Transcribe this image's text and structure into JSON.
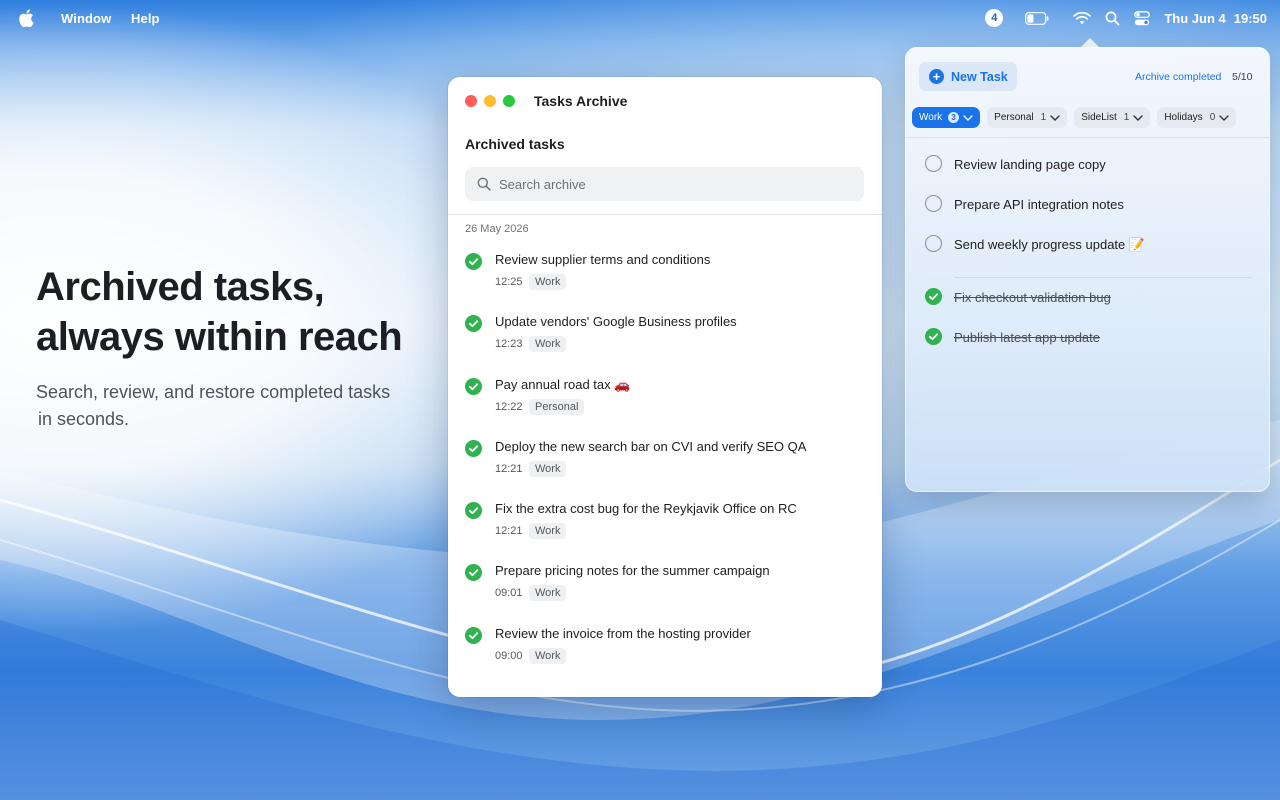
{
  "menubar": {
    "menus": [
      "Window",
      "Help"
    ],
    "notification_count": "4",
    "date": "Thu Jun 4",
    "time": "19:50"
  },
  "hero": {
    "title_line1": "Archived tasks,",
    "title_line2": "always within reach",
    "subtitle_line1": "Search, review, and restore completed tasks",
    "subtitle_line2": "in seconds."
  },
  "archive_window": {
    "title": "Tasks Archive",
    "heading": "Archived tasks",
    "search_placeholder": "Search archive",
    "date_group": "26 May 2026",
    "items": [
      {
        "title": "Review supplier terms and conditions",
        "time": "12:25",
        "tag": "Work"
      },
      {
        "title": "Update vendors' Google Business profiles",
        "time": "12:23",
        "tag": "Work"
      },
      {
        "title": "Pay annual road tax 🚗",
        "time": "12:22",
        "tag": "Personal"
      },
      {
        "title": "Deploy the new search bar on CVI and verify SEO QA",
        "time": "12:21",
        "tag": "Work"
      },
      {
        "title": "Fix the extra cost bug for the Reykjavik Office on RC",
        "time": "12:21",
        "tag": "Work"
      },
      {
        "title": "Prepare pricing notes for the summer campaign",
        "time": "09:01",
        "tag": "Work"
      },
      {
        "title": "Review the invoice from the hosting provider",
        "time": "09:00",
        "tag": "Work"
      }
    ]
  },
  "popover": {
    "new_task_label": "New Task",
    "archive_completed_label": "Archive completed",
    "count": "5/10",
    "lists": [
      {
        "name": "Work",
        "count": "3",
        "active": true
      },
      {
        "name": "Personal",
        "count": "1",
        "active": false
      },
      {
        "name": "SideList",
        "count": "1",
        "active": false
      },
      {
        "name": "Holidays",
        "count": "0",
        "active": false
      }
    ],
    "open_tasks": [
      "Review landing page copy",
      "Prepare API integration notes",
      "Send weekly progress update 📝"
    ],
    "done_tasks": [
      "Fix checkout validation bug",
      "Publish latest app update"
    ]
  },
  "colors": {
    "accent": "#1a73e8",
    "check_green": "#2fb24f",
    "close": "#ff5f57",
    "minimize": "#febc2e",
    "zoom": "#28c840"
  },
  "icons": [
    "apple-icon",
    "battery-icon",
    "wifi-icon",
    "search-icon",
    "control-center-icon",
    "check-circle-icon",
    "chevron-down-icon",
    "plus-icon"
  ]
}
